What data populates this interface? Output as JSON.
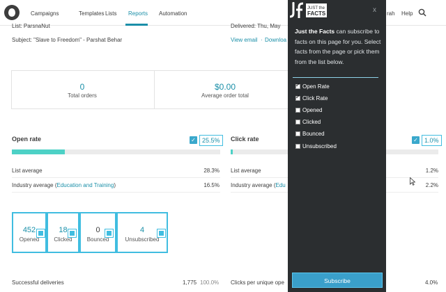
{
  "nav": {
    "items": [
      "Campaigns",
      "Templates",
      "Lists",
      "Reports",
      "Automation"
    ],
    "user_partial": "rah",
    "help": "Help"
  },
  "campaign": {
    "list": "List: ParsnaNut",
    "subject": "Subject: \"Slave to Freedom\" - Parshat Behar",
    "delivered": "Delivered: Thu, May ",
    "view_email": "View email",
    "sep": "·",
    "download": "Downloa"
  },
  "orders": {
    "total_orders_value": "0",
    "total_orders_label": "Total orders",
    "avg_order_value": "$0.00",
    "avg_order_label": "Average order total"
  },
  "open_rate": {
    "title": "Open rate",
    "value": "25.5%",
    "fill_fraction": 0.255,
    "list_average_label": "List average",
    "list_average_value": "28.3%",
    "industry_label": "Industry average (",
    "industry_link": "Education and Training",
    "industry_close": ")",
    "industry_value": "16.5%"
  },
  "click_rate": {
    "title": "Click rate",
    "value": "1.0%",
    "fill_fraction": 0.01,
    "list_average_label": "List average",
    "list_average_value": "1.2%",
    "industry_label": "Industry average (",
    "industry_link": "Edu",
    "industry_value": "2.2%"
  },
  "tiles": [
    {
      "value": "452",
      "label": "Opened"
    },
    {
      "value": "18",
      "label": "Clicked"
    },
    {
      "value": "0",
      "label": "Bounced"
    },
    {
      "value": "4",
      "label": "Unsubscribed"
    }
  ],
  "bottom": {
    "successful_label": "Successful deliveries",
    "successful_count": "1,775",
    "successful_pct": "100.0%",
    "clicks_label": "Clicks per unique ope",
    "clicks_value": "4.0%"
  },
  "jf": {
    "logo_text_1": "JUST the",
    "logo_text_2": "FACTS",
    "close": "x",
    "intro_bold": "Just the Facts",
    "intro_rest": " can subscribe to facts on this page for you. Select facts from the page or pick them from the list below.",
    "items": [
      {
        "label": "Open Rate",
        "checked": true
      },
      {
        "label": "Click Rate",
        "checked": true
      },
      {
        "label": "Opened",
        "checked": false
      },
      {
        "label": "Clicked",
        "checked": false
      },
      {
        "label": "Bounced",
        "checked": false
      },
      {
        "label": "Unsubscribed",
        "checked": false
      }
    ],
    "subscribe": "Subscribe"
  },
  "colors": {
    "accent": "#1a8fa8",
    "bar_fill": "#4dd1c6",
    "highlight": "#40bde0",
    "panel_bg": "#2b2e30",
    "subscribe_bg": "#3a9fca"
  }
}
